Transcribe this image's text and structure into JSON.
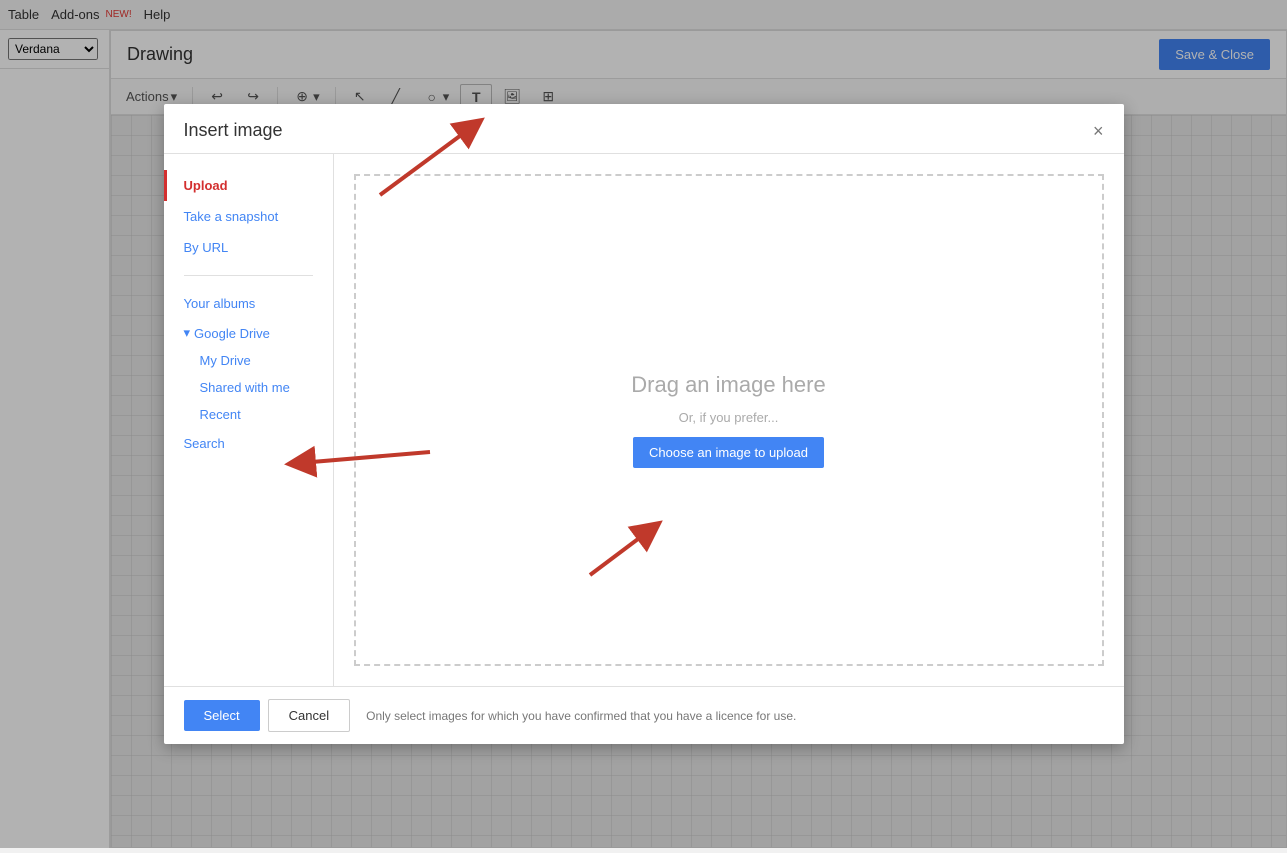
{
  "topmenu": {
    "items": [
      {
        "label": "Table",
        "id": "table"
      },
      {
        "label": "Add-ons",
        "id": "addons"
      },
      {
        "label": "NEW!",
        "id": "new-badge"
      },
      {
        "label": "Help",
        "id": "help"
      }
    ]
  },
  "sidebar": {
    "font_label": "Verdana",
    "font_arrow": "▾"
  },
  "drawing": {
    "title": "Drawing",
    "save_close": "Save & Close",
    "toolbar": {
      "actions_label": "Actions",
      "actions_arrow": "▾",
      "undo": "↩",
      "redo": "↪",
      "zoom": "🔍",
      "zoom_arrow": "▾"
    }
  },
  "dialog": {
    "title": "Insert image",
    "close_label": "×",
    "nav": {
      "upload": "Upload",
      "take_snapshot": "Take a snapshot",
      "by_url": "By URL",
      "your_albums": "Your albums",
      "google_drive": "Google Drive",
      "google_drive_arrow": "▾",
      "my_drive": "My Drive",
      "shared_with_me": "Shared with me",
      "recent": "Recent",
      "search": "Search"
    },
    "upload_area": {
      "drag_text": "Drag an image here",
      "or_text": "Or, if you prefer...",
      "choose_btn": "Choose an image to upload"
    },
    "footer": {
      "select_label": "Select",
      "cancel_label": "Cancel",
      "license_text": "Only select images for which you have confirmed that you have a licence for use."
    }
  }
}
